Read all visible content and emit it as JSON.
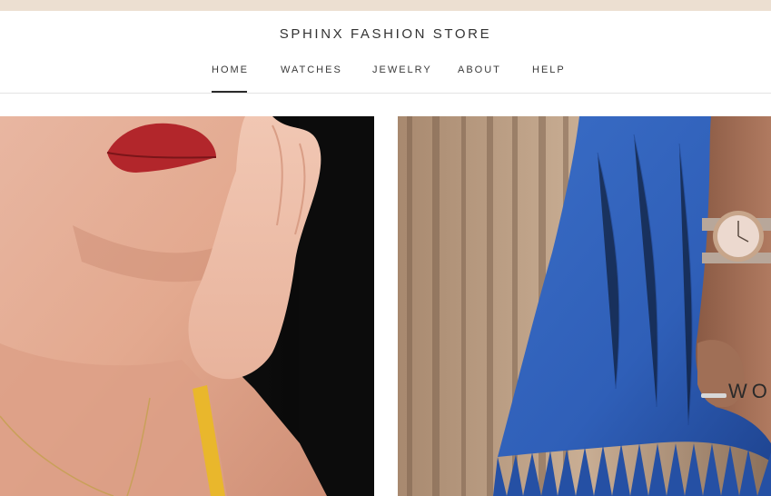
{
  "header": {
    "store_name": "SPHINX FASHION STORE"
  },
  "nav": {
    "items": [
      {
        "label": "HOME",
        "active": true
      },
      {
        "label": "WATCHES",
        "active": false
      },
      {
        "label": "JEWELRY",
        "active": false
      },
      {
        "label": "ABOUT",
        "active": false
      },
      {
        "label": "HELP",
        "active": false
      }
    ]
  },
  "hero": {
    "right_overlay_text": "WO"
  },
  "colors": {
    "topbar": "#ecdfd1",
    "nav_text": "#3a3a3a",
    "denim": "#2f5fb8",
    "lip": "#b2262b"
  }
}
